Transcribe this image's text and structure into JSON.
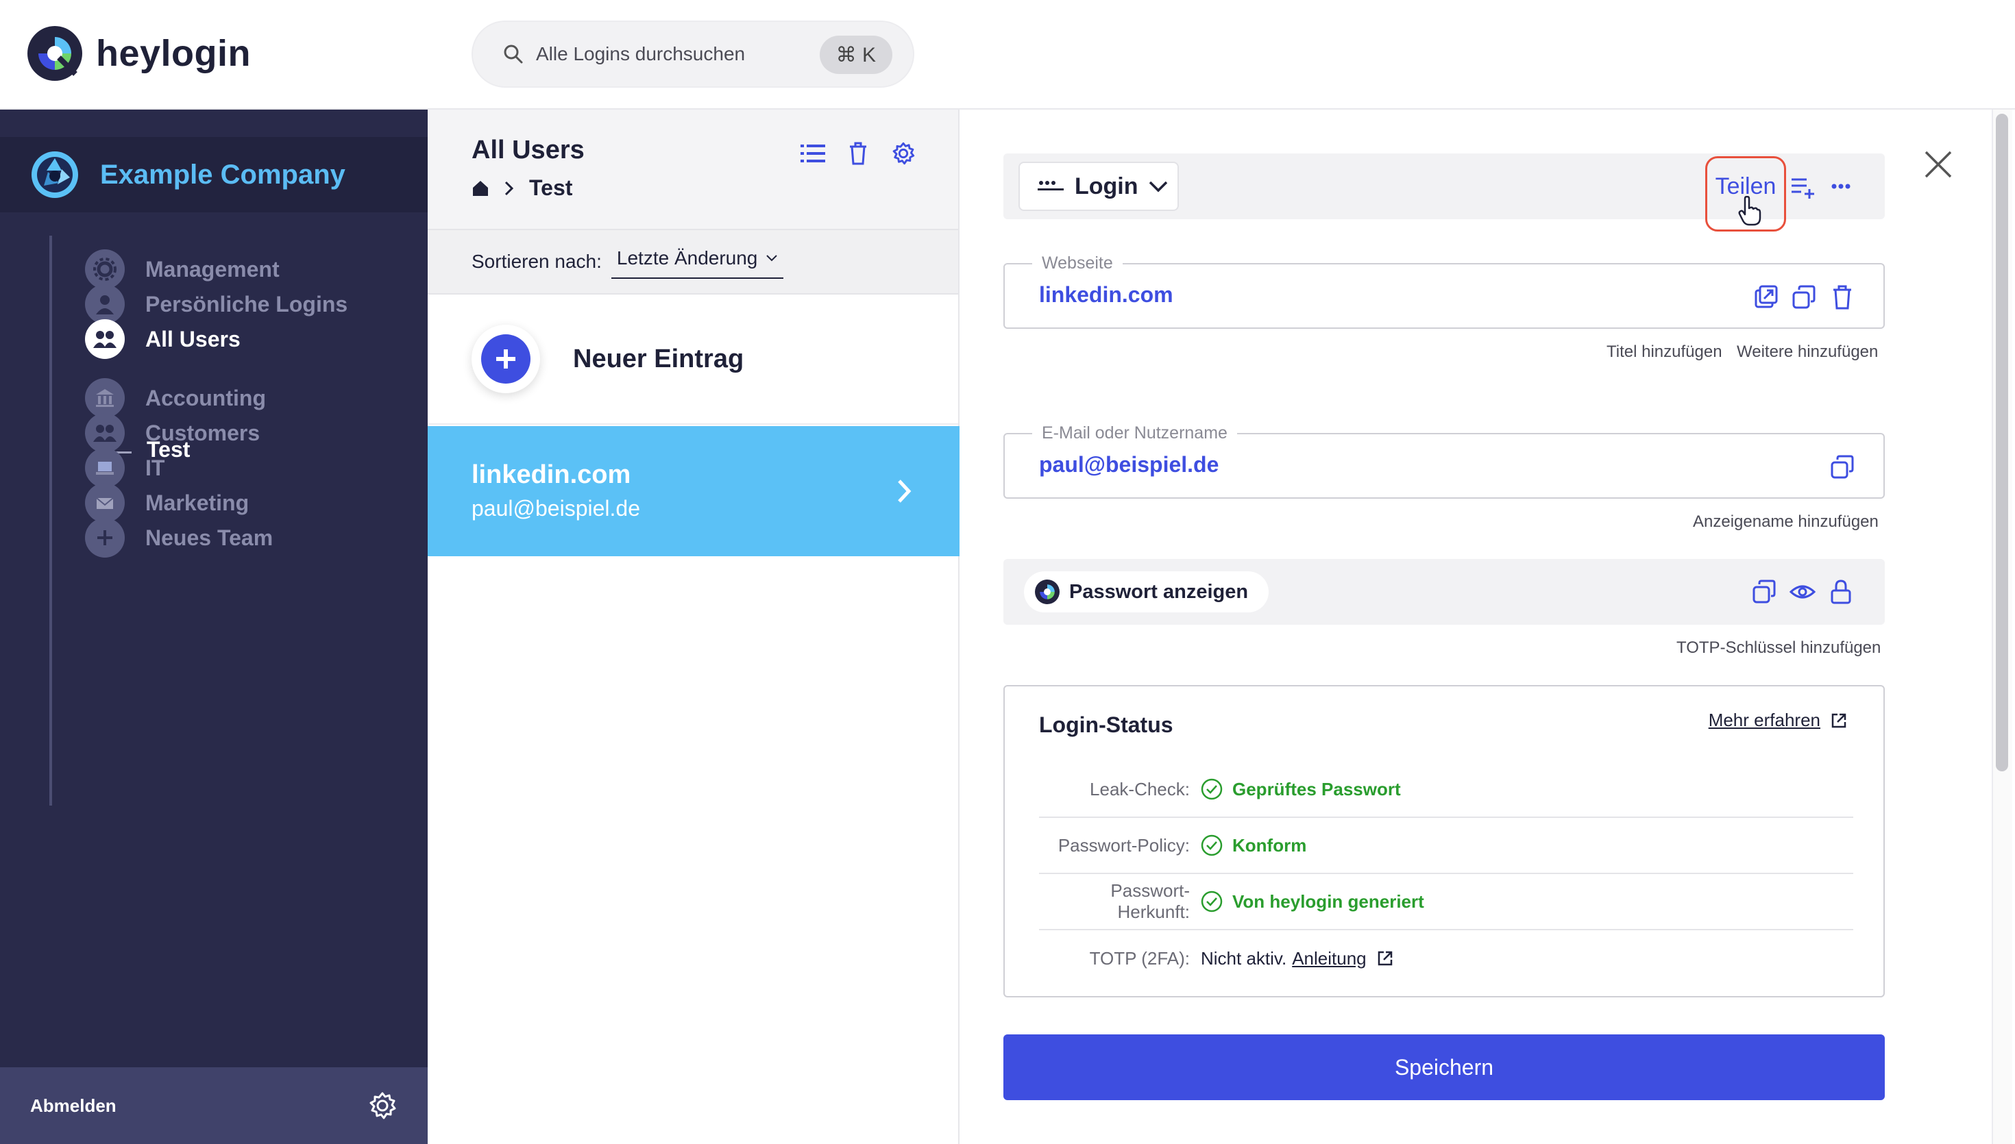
{
  "app": {
    "name": "heylogin"
  },
  "search": {
    "placeholder": "Alle Logins durchsuchen",
    "shortcut": "⌘ K"
  },
  "sidebar": {
    "company": "Example Company",
    "items": [
      {
        "label": "Management",
        "icon": "gear-icon"
      },
      {
        "label": "Persönliche Logins",
        "icon": "person-icon"
      },
      {
        "label": "All Users",
        "icon": "group-icon",
        "active": true
      },
      {
        "label": "Test",
        "sub": true
      },
      {
        "label": "Accounting",
        "icon": "bank-icon"
      },
      {
        "label": "Customers",
        "icon": "group-icon"
      },
      {
        "label": "IT",
        "icon": "laptop-icon"
      },
      {
        "label": "Marketing",
        "icon": "mail-icon"
      },
      {
        "label": "Neues Team",
        "icon": "plus-icon"
      }
    ],
    "logout": "Abmelden"
  },
  "list": {
    "title": "All Users",
    "breadcrumb": [
      "Test"
    ],
    "sort_label": "Sortieren nach:",
    "sort_value": "Letzte Änderung",
    "new_entry": "Neuer Eintrag",
    "entries": [
      {
        "title": "linkedin.com",
        "subtitle": "paul@beispiel.de"
      }
    ]
  },
  "detail": {
    "type": "Login",
    "share": "Teilen",
    "website_label": "Webseite",
    "website_value": "linkedin.com",
    "hint_title": "Titel hinzufügen",
    "hint_more": "Weitere hinzufügen",
    "user_label": "E-Mail oder Nutzername",
    "user_value": "paul@beispiel.de",
    "hint_display": "Anzeigename hinzufügen",
    "password_button": "Passwort anzeigen",
    "hint_totp": "TOTP-Schlüssel hinzufügen",
    "status": {
      "title": "Login-Status",
      "more": "Mehr erfahren",
      "rows": [
        {
          "label": "Leak-Check:",
          "value": "Geprüftes Passwort"
        },
        {
          "label": "Passwort-Policy:",
          "value": "Konform"
        },
        {
          "label": "Passwort-Herkunft:",
          "value": "Von heylogin generiert"
        },
        {
          "label": "TOTP (2FA):",
          "value": "Nicht aktiv.",
          "link": "Anleitung"
        }
      ]
    },
    "save": "Speichern"
  },
  "colors": {
    "accent": "#3e4ee0",
    "sidebar": "#292a4a",
    "selected": "#5bc1f6",
    "ok": "#2a9d2e",
    "highlight": "#e8503c"
  }
}
